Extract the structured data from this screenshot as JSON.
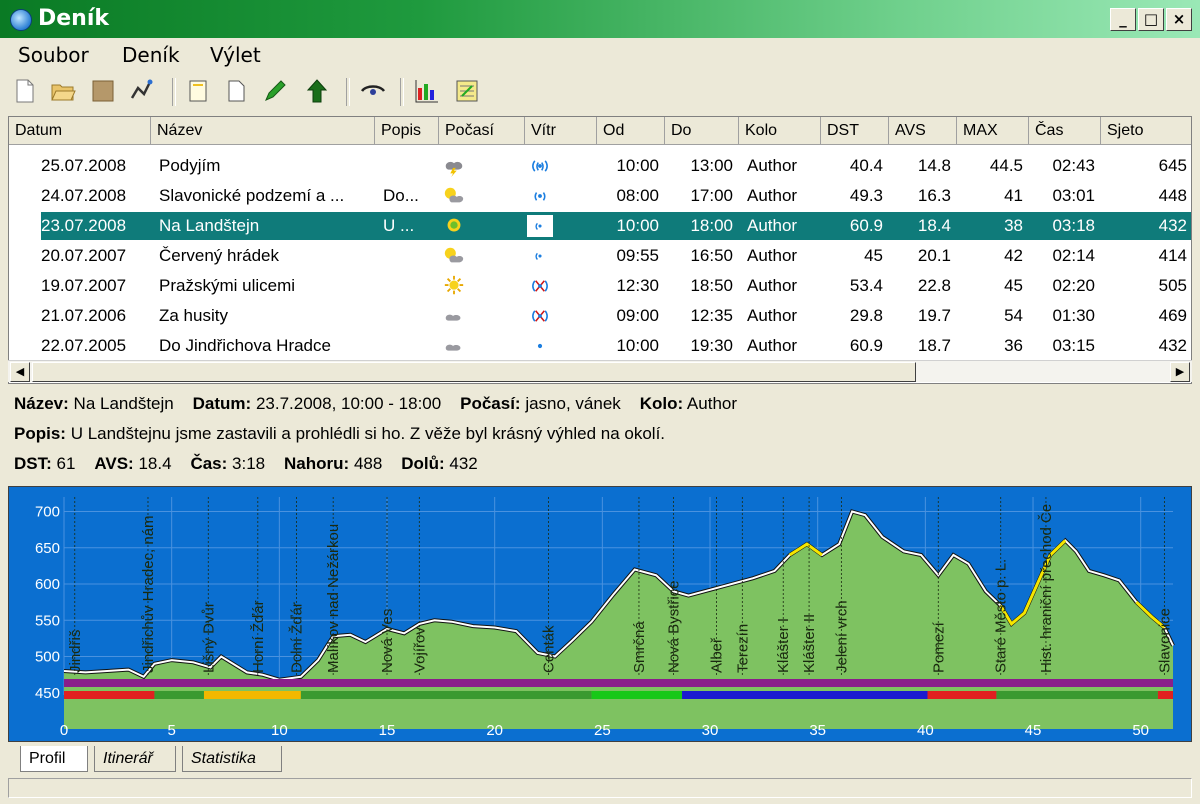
{
  "window": {
    "title": "Deník",
    "min": "_",
    "max": "□",
    "close": "×"
  },
  "menu": [
    "Soubor",
    "Deník",
    "Výlet"
  ],
  "toolbar_icons": [
    "new-icon",
    "open-icon",
    "save-icon",
    "route-icon",
    "copy-icon",
    "paste-icon",
    "edit-icon",
    "arrow-up-icon",
    "eye-icon",
    "chart-icon",
    "calculator-icon"
  ],
  "table": {
    "columns": [
      "Datum",
      "Název",
      "Popis",
      "Počasí",
      "Vítr",
      "Od",
      "Do",
      "Kolo",
      "DST",
      "AVS",
      "MAX",
      "Čas",
      "Sjeto"
    ],
    "rows": [
      {
        "date": "25.07.2008",
        "name": "Podyjím",
        "desc": "",
        "weather": "storm",
        "wind": "strong",
        "od": "10:00",
        "do": "13:00",
        "kolo": "Author",
        "dst": "40.4",
        "avs": "14.8",
        "max": "44.5",
        "cas": "02:43",
        "sjeto": "645"
      },
      {
        "date": "24.07.2008",
        "name": "Slavonické podzemí a ...",
        "desc": "Do...",
        "weather": "partly",
        "wind": "medium",
        "od": "08:00",
        "do": "17:00",
        "kolo": "Author",
        "dst": "49.3",
        "avs": "16.3",
        "max": "41",
        "cas": "03:01",
        "sjeto": "448"
      },
      {
        "date": "23.07.2008",
        "name": "Na Landštejn",
        "desc": "U ...",
        "weather": "sunny-green",
        "wind": "light",
        "od": "10:00",
        "do": "18:00",
        "kolo": "Author",
        "dst": "60.9",
        "avs": "18.4",
        "max": "38",
        "cas": "03:18",
        "sjeto": "432"
      },
      {
        "date": "20.07.2007",
        "name": "Červený hrádek",
        "desc": "",
        "weather": "partly",
        "wind": "light",
        "od": "09:55",
        "do": "16:50",
        "kolo": "Author",
        "dst": "45",
        "avs": "20.1",
        "max": "42",
        "cas": "02:14",
        "sjeto": "414"
      },
      {
        "date": "19.07.2007",
        "name": "Pražskými ulicemi",
        "desc": "",
        "weather": "sunny",
        "wind": "cross",
        "od": "12:30",
        "do": "18:50",
        "kolo": "Author",
        "dst": "53.4",
        "avs": "22.8",
        "max": "45",
        "cas": "02:20",
        "sjeto": "505"
      },
      {
        "date": "21.07.2006",
        "name": "Za husity",
        "desc": "",
        "weather": "cloudy",
        "wind": "cross",
        "od": "09:00",
        "do": "12:35",
        "kolo": "Author",
        "dst": "29.8",
        "avs": "19.7",
        "max": "54",
        "cas": "01:30",
        "sjeto": "469"
      },
      {
        "date": "22.07.2005",
        "name": "Do Jindřichova Hradce",
        "desc": "",
        "weather": "cloudy",
        "wind": "calm",
        "od": "10:00",
        "do": "19:30",
        "kolo": "Author",
        "dst": "60.9",
        "avs": "18.7",
        "max": "36",
        "cas": "03:15",
        "sjeto": "432"
      }
    ],
    "selected_index": 2
  },
  "detail": {
    "l_name": "Název:",
    "v_name": "Na Landštejn",
    "l_date": "Datum:",
    "v_date": "23.7.2008, 10:00 - 18:00",
    "l_weather": "Počasí:",
    "v_weather": "jasno, vánek",
    "l_kolo": "Kolo:",
    "v_kolo": "Author",
    "l_popis": "Popis:",
    "v_popis": "U Landštejnu jsme zastavili a prohlédli si ho. Z věže byl krásný výhled na okolí.",
    "l_dst": "DST:",
    "v_dst": "61",
    "l_avs": "AVS:",
    "v_avs": "18.4",
    "l_cas": "Čas:",
    "v_cas": "3:18",
    "l_nahoru": "Nahoru:",
    "v_nahoru": "488",
    "l_dolu": "Dolů:",
    "v_dolu": "432"
  },
  "profile": {
    "y_ticks": [
      "700",
      "650",
      "600",
      "550",
      "500",
      "450"
    ],
    "x_ticks": [
      "0",
      "5",
      "10",
      "15",
      "20",
      "25",
      "30",
      "35",
      "40",
      "45",
      "50"
    ],
    "places": [
      {
        "label": "Jindřiš",
        "km": 0.5
      },
      {
        "label": "Jindřichův Hradec, nám",
        "km": 3.9
      },
      {
        "label": "Lišný Dvůr",
        "km": 6.7
      },
      {
        "label": "Horní Žďár",
        "km": 9.0
      },
      {
        "label": "Dolní Žďár",
        "km": 10.8
      },
      {
        "label": "Malíkov nad Nežárkou",
        "km": 12.5
      },
      {
        "label": "Nová Ves",
        "km": 15.0
      },
      {
        "label": "Vojířov",
        "km": 16.5
      },
      {
        "label": "Centák",
        "km": 22.5
      },
      {
        "label": "Smrčná",
        "km": 26.7
      },
      {
        "label": "Nová Bystřice",
        "km": 28.3
      },
      {
        "label": "Albeř",
        "km": 30.3
      },
      {
        "label": "Terezín",
        "km": 31.5
      },
      {
        "label": "Klášter I",
        "km": 33.4
      },
      {
        "label": "Klášter II",
        "km": 34.6
      },
      {
        "label": "Jelení vrch",
        "km": 36.1
      },
      {
        "label": "Pomezí",
        "km": 40.6
      },
      {
        "label": "Staré Město p. L.",
        "km": 43.5
      },
      {
        "label": "Hist. hraniční přechod Če",
        "km": 45.6
      },
      {
        "label": "Slavonice",
        "km": 51.1
      }
    ]
  },
  "tabs": [
    "Profil",
    "Itinerář",
    "Statistika"
  ]
}
